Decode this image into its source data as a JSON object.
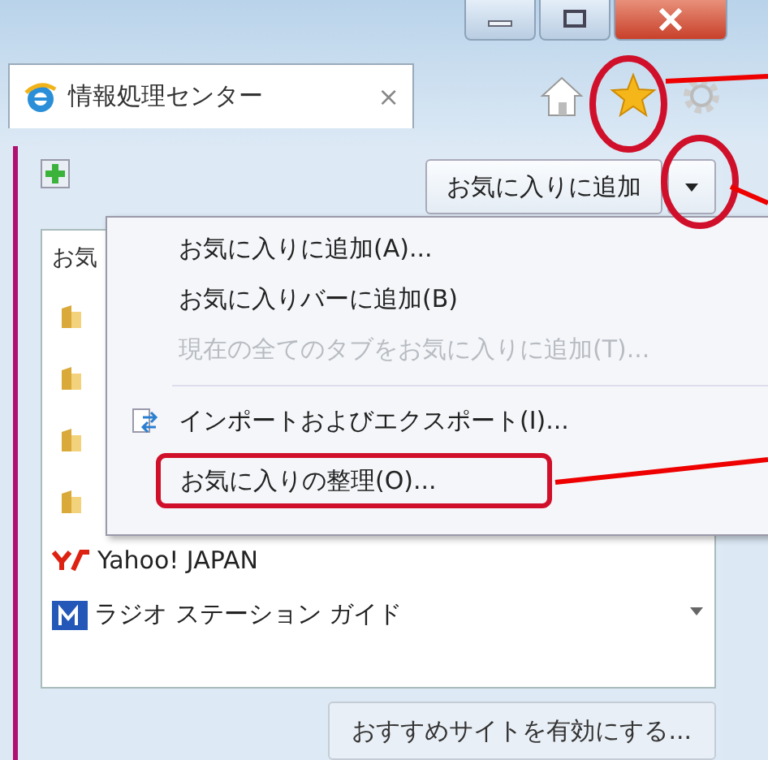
{
  "tab": {
    "title": "情報処理センター",
    "close": "×"
  },
  "add_button": {
    "label": "お気に入りに追加"
  },
  "favorites": {
    "header": "お気",
    "items": [
      {
        "kind": "folder"
      },
      {
        "kind": "folder"
      },
      {
        "kind": "folder"
      },
      {
        "kind": "folder"
      },
      {
        "kind": "site",
        "label": "Yahoo! JAPAN"
      },
      {
        "kind": "site",
        "label": "ラジオ ステーション ガイド"
      }
    ]
  },
  "menu": {
    "items": [
      {
        "kind": "item",
        "label": "お気に入りに追加(A)...",
        "disabled": false,
        "annotated": false
      },
      {
        "kind": "item",
        "label": "お気に入りバーに追加(B)",
        "disabled": false,
        "annotated": false
      },
      {
        "kind": "item",
        "label": "現在の全てのタブをお気に入りに追加(T)...",
        "disabled": true,
        "annotated": false
      },
      {
        "kind": "separator"
      },
      {
        "kind": "icon-item",
        "label": "インポートおよびエクスポート(I)...",
        "disabled": false,
        "annotated": false
      },
      {
        "kind": "item",
        "label": "お気に入りの整理(O)...",
        "disabled": false,
        "annotated": true
      }
    ]
  },
  "suggest_button": {
    "label": "おすすめサイトを有効にする..."
  }
}
